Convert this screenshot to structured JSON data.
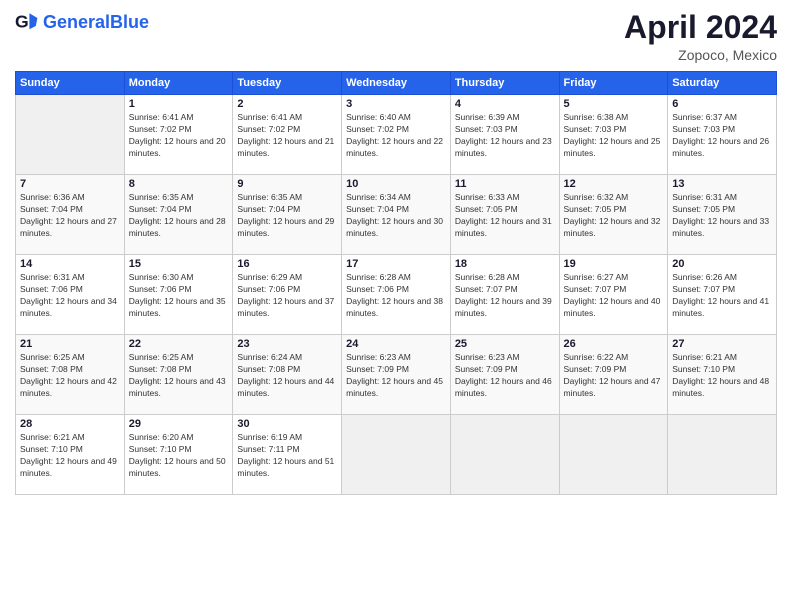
{
  "header": {
    "logo_general": "General",
    "logo_blue": "Blue",
    "title": "April 2024",
    "location": "Zopoco, Mexico"
  },
  "calendar": {
    "days_of_week": [
      "Sunday",
      "Monday",
      "Tuesday",
      "Wednesday",
      "Thursday",
      "Friday",
      "Saturday"
    ],
    "weeks": [
      [
        {
          "day": "",
          "empty": true
        },
        {
          "day": "1",
          "sunrise": "6:41 AM",
          "sunset": "7:02 PM",
          "daylight": "12 hours and 20 minutes."
        },
        {
          "day": "2",
          "sunrise": "6:41 AM",
          "sunset": "7:02 PM",
          "daylight": "12 hours and 21 minutes."
        },
        {
          "day": "3",
          "sunrise": "6:40 AM",
          "sunset": "7:02 PM",
          "daylight": "12 hours and 22 minutes."
        },
        {
          "day": "4",
          "sunrise": "6:39 AM",
          "sunset": "7:03 PM",
          "daylight": "12 hours and 23 minutes."
        },
        {
          "day": "5",
          "sunrise": "6:38 AM",
          "sunset": "7:03 PM",
          "daylight": "12 hours and 25 minutes."
        },
        {
          "day": "6",
          "sunrise": "6:37 AM",
          "sunset": "7:03 PM",
          "daylight": "12 hours and 26 minutes."
        }
      ],
      [
        {
          "day": "7",
          "sunrise": "6:36 AM",
          "sunset": "7:04 PM",
          "daylight": "12 hours and 27 minutes."
        },
        {
          "day": "8",
          "sunrise": "6:35 AM",
          "sunset": "7:04 PM",
          "daylight": "12 hours and 28 minutes."
        },
        {
          "day": "9",
          "sunrise": "6:35 AM",
          "sunset": "7:04 PM",
          "daylight": "12 hours and 29 minutes."
        },
        {
          "day": "10",
          "sunrise": "6:34 AM",
          "sunset": "7:04 PM",
          "daylight": "12 hours and 30 minutes."
        },
        {
          "day": "11",
          "sunrise": "6:33 AM",
          "sunset": "7:05 PM",
          "daylight": "12 hours and 31 minutes."
        },
        {
          "day": "12",
          "sunrise": "6:32 AM",
          "sunset": "7:05 PM",
          "daylight": "12 hours and 32 minutes."
        },
        {
          "day": "13",
          "sunrise": "6:31 AM",
          "sunset": "7:05 PM",
          "daylight": "12 hours and 33 minutes."
        }
      ],
      [
        {
          "day": "14",
          "sunrise": "6:31 AM",
          "sunset": "7:06 PM",
          "daylight": "12 hours and 34 minutes."
        },
        {
          "day": "15",
          "sunrise": "6:30 AM",
          "sunset": "7:06 PM",
          "daylight": "12 hours and 35 minutes."
        },
        {
          "day": "16",
          "sunrise": "6:29 AM",
          "sunset": "7:06 PM",
          "daylight": "12 hours and 37 minutes."
        },
        {
          "day": "17",
          "sunrise": "6:28 AM",
          "sunset": "7:06 PM",
          "daylight": "12 hours and 38 minutes."
        },
        {
          "day": "18",
          "sunrise": "6:28 AM",
          "sunset": "7:07 PM",
          "daylight": "12 hours and 39 minutes."
        },
        {
          "day": "19",
          "sunrise": "6:27 AM",
          "sunset": "7:07 PM",
          "daylight": "12 hours and 40 minutes."
        },
        {
          "day": "20",
          "sunrise": "6:26 AM",
          "sunset": "7:07 PM",
          "daylight": "12 hours and 41 minutes."
        }
      ],
      [
        {
          "day": "21",
          "sunrise": "6:25 AM",
          "sunset": "7:08 PM",
          "daylight": "12 hours and 42 minutes."
        },
        {
          "day": "22",
          "sunrise": "6:25 AM",
          "sunset": "7:08 PM",
          "daylight": "12 hours and 43 minutes."
        },
        {
          "day": "23",
          "sunrise": "6:24 AM",
          "sunset": "7:08 PM",
          "daylight": "12 hours and 44 minutes."
        },
        {
          "day": "24",
          "sunrise": "6:23 AM",
          "sunset": "7:09 PM",
          "daylight": "12 hours and 45 minutes."
        },
        {
          "day": "25",
          "sunrise": "6:23 AM",
          "sunset": "7:09 PM",
          "daylight": "12 hours and 46 minutes."
        },
        {
          "day": "26",
          "sunrise": "6:22 AM",
          "sunset": "7:09 PM",
          "daylight": "12 hours and 47 minutes."
        },
        {
          "day": "27",
          "sunrise": "6:21 AM",
          "sunset": "7:10 PM",
          "daylight": "12 hours and 48 minutes."
        }
      ],
      [
        {
          "day": "28",
          "sunrise": "6:21 AM",
          "sunset": "7:10 PM",
          "daylight": "12 hours and 49 minutes."
        },
        {
          "day": "29",
          "sunrise": "6:20 AM",
          "sunset": "7:10 PM",
          "daylight": "12 hours and 50 minutes."
        },
        {
          "day": "30",
          "sunrise": "6:19 AM",
          "sunset": "7:11 PM",
          "daylight": "12 hours and 51 minutes."
        },
        {
          "day": "",
          "empty": true
        },
        {
          "day": "",
          "empty": true
        },
        {
          "day": "",
          "empty": true
        },
        {
          "day": "",
          "empty": true
        }
      ]
    ]
  }
}
